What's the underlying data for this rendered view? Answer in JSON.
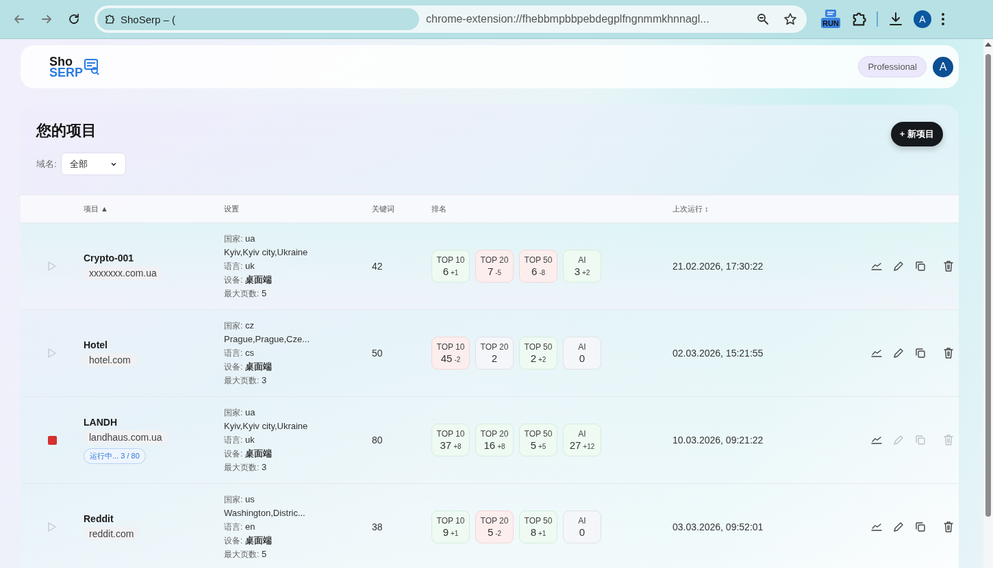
{
  "browser": {
    "tab_title": "ShoSerp – (",
    "url": "chrome-extension://fhebbmpbbpebdegplfngnmmkhnnagl...",
    "extension_label": "RUN",
    "avatar": "A"
  },
  "header": {
    "logo_top": "Sho",
    "logo_bottom": "SERP",
    "plan": "Professional",
    "avatar": "A"
  },
  "projects": {
    "title": "您的项目",
    "new_button": "+ 新项目",
    "filter": {
      "label": "域名:",
      "value": "全部"
    },
    "columns": [
      {
        "label": "项目",
        "sort_mark": "▲"
      },
      {
        "label": "设置"
      },
      {
        "label": "关键词"
      },
      {
        "label": "排名"
      },
      {
        "label": "上次运行",
        "sort_mark": "↕"
      }
    ],
    "rows": [
      {
        "name": "Crypto-001",
        "domain": "xxxxxxx.com.ua",
        "running": false,
        "settings": [
          {
            "label": "国家:",
            "value": "ua"
          },
          {
            "value": "Kyiv,Kyiv city,Ukraine"
          },
          {
            "label": "语言:",
            "value": "uk"
          },
          {
            "label": "设备:",
            "value": "桌面端"
          },
          {
            "label": "最大页数:",
            "value": "5"
          }
        ],
        "keywords": "42",
        "rankings": [
          {
            "label": "TOP 10",
            "value": "6",
            "delta": "+1",
            "kind": "up"
          },
          {
            "label": "TOP 20",
            "value": "7",
            "delta": "-5",
            "kind": "down"
          },
          {
            "label": "TOP 50",
            "value": "6",
            "delta": "-8",
            "kind": "down"
          },
          {
            "label": "AI",
            "value": "3",
            "delta": "+2",
            "kind": "up"
          }
        ],
        "last_run": "21.02.2026, 17:30:22",
        "actions_disabled": false
      },
      {
        "name": "Hotel",
        "domain": "hotel.com",
        "running": false,
        "settings": [
          {
            "label": "国家:",
            "value": "cz"
          },
          {
            "value": "Prague,Prague,Cze..."
          },
          {
            "label": "语言:",
            "value": "cs"
          },
          {
            "label": "设备:",
            "value": "桌面端"
          },
          {
            "label": "最大页数:",
            "value": "3"
          }
        ],
        "keywords": "50",
        "rankings": [
          {
            "label": "TOP 10",
            "value": "45",
            "delta": "-2",
            "kind": "down"
          },
          {
            "label": "TOP 20",
            "value": "2",
            "kind": "flat"
          },
          {
            "label": "TOP 50",
            "value": "2",
            "delta": "+2",
            "kind": "up"
          },
          {
            "label": "AI",
            "value": "0",
            "kind": "flat"
          }
        ],
        "last_run": "02.03.2026, 15:21:55",
        "actions_disabled": false
      },
      {
        "name": "LANDH",
        "domain": "landhaus.com.ua",
        "running": true,
        "progress": "运行中... 3 / 80",
        "settings": [
          {
            "label": "国家:",
            "value": "ua"
          },
          {
            "value": "Kyiv,Kyiv city,Ukraine"
          },
          {
            "label": "语言:",
            "value": "uk"
          },
          {
            "label": "设备:",
            "value": "桌面端"
          },
          {
            "label": "最大页数:",
            "value": "3"
          }
        ],
        "keywords": "80",
        "rankings": [
          {
            "label": "TOP 10",
            "value": "37",
            "delta": "+8",
            "kind": "up"
          },
          {
            "label": "TOP 20",
            "value": "16",
            "delta": "+8",
            "kind": "up"
          },
          {
            "label": "TOP 50",
            "value": "5",
            "delta": "+5",
            "kind": "up"
          },
          {
            "label": "AI",
            "value": "27",
            "delta": "+12",
            "kind": "up"
          }
        ],
        "last_run": "10.03.2026, 09:21:22",
        "actions_disabled": true
      },
      {
        "name": "Reddit",
        "domain": "reddit.com",
        "running": false,
        "settings": [
          {
            "label": "国家:",
            "value": "us"
          },
          {
            "value": "Washington,Distric..."
          },
          {
            "label": "语言:",
            "value": "en"
          },
          {
            "label": "设备:",
            "value": "桌面端"
          },
          {
            "label": "最大页数:",
            "value": "5"
          }
        ],
        "keywords": "38",
        "rankings": [
          {
            "label": "TOP 10",
            "value": "9",
            "delta": "+1",
            "kind": "up"
          },
          {
            "label": "TOP 20",
            "value": "5",
            "delta": "-2",
            "kind": "down"
          },
          {
            "label": "TOP 50",
            "value": "8",
            "delta": "+1",
            "kind": "up"
          },
          {
            "label": "AI",
            "value": "0",
            "kind": "flat"
          }
        ],
        "last_run": "03.03.2026, 09:52:01",
        "actions_disabled": false
      }
    ]
  }
}
